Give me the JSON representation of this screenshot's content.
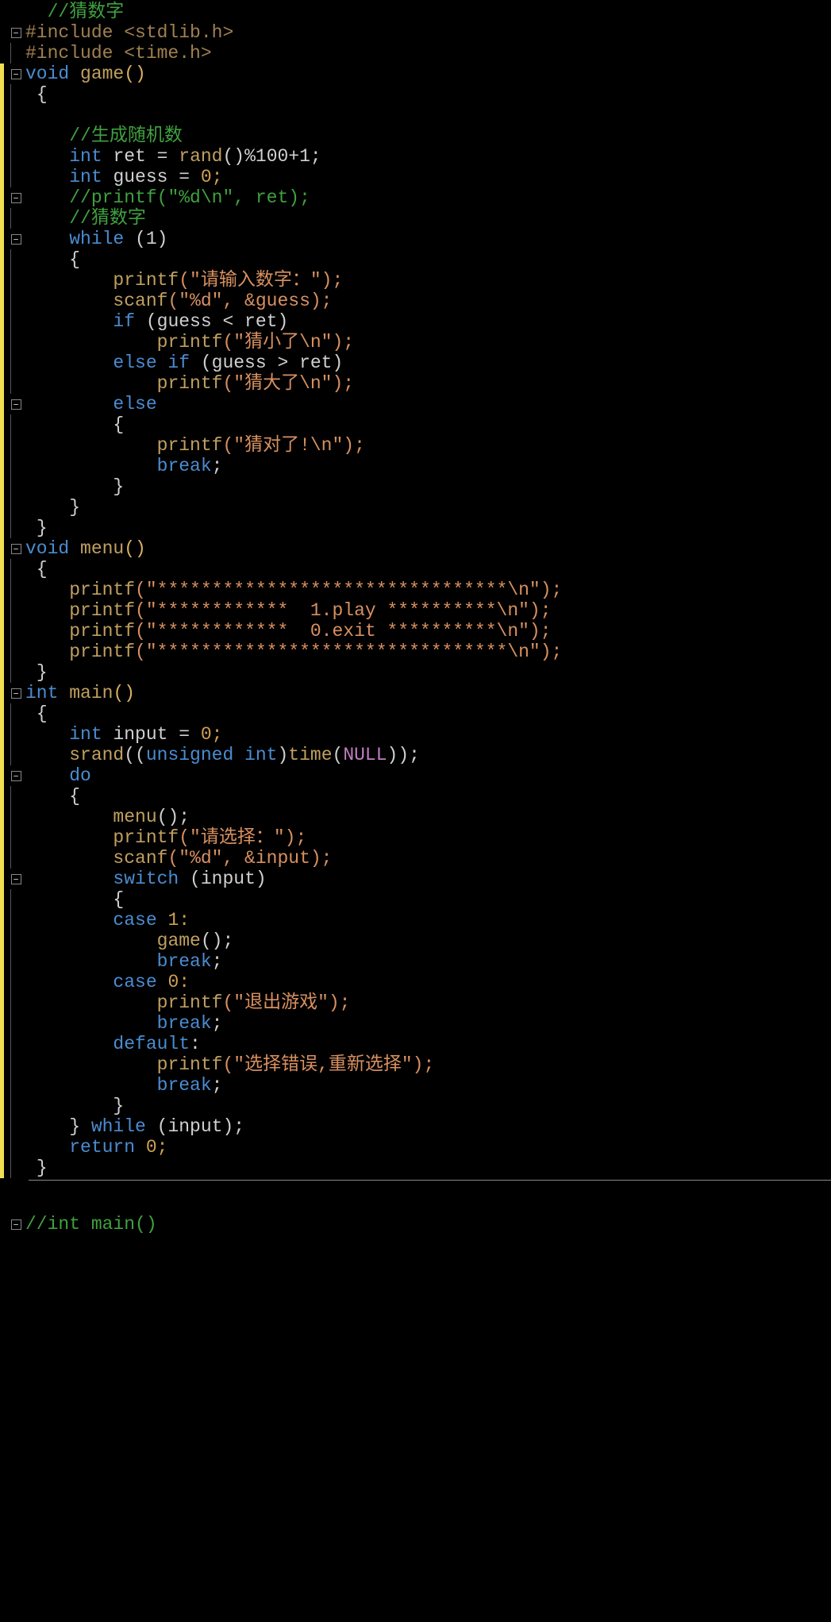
{
  "code": {
    "l1_comment": "//猜数字",
    "l2_include": "#include",
    "l2_file": " <stdlib.h>",
    "l3_include": "#include",
    "l3_file": " <time.h>",
    "l4_void": "void",
    "l4_func": " game",
    "l4_paren": "()",
    "l5_brace": "{",
    "l6_blank": "",
    "l7_comment": "//生成随机数",
    "l8_int": "int",
    "l8_var": " ret ",
    "l8_eq": "= ",
    "l8_rand": "rand",
    "l8_rest": "()%100+1;",
    "l9_int": "int",
    "l9_var": " guess ",
    "l9_eq": "= ",
    "l9_val": "0;",
    "l10_comment": "//printf(\"%d\\n\", ret);",
    "l11_comment": "//猜数字",
    "l12_while": "while",
    "l12_cond": " (1)",
    "l13_brace": "{",
    "l14_printf": "printf",
    "l14_args": "(\"请输入数字：\");",
    "l15_scanf": "scanf",
    "l15_args": "(\"%d\", &guess);",
    "l16_if": "if",
    "l16_cond": " (guess < ret)",
    "l17_printf": "printf",
    "l17_args": "(\"猜小了\\n\");",
    "l18_else": "else if",
    "l18_cond": " (guess > ret)",
    "l19_printf": "printf",
    "l19_args": "(\"猜大了\\n\");",
    "l20_else": "else",
    "l21_brace": "{",
    "l22_printf": "printf",
    "l22_args": "(\"猜对了!\\n\");",
    "l23_break": "break",
    "l23_sc": ";",
    "l24_brace": "}",
    "l25_brace": "}",
    "l26_brace": "}",
    "l27_void": "void",
    "l27_func": " menu",
    "l27_paren": "()",
    "l28_brace": "{",
    "l29_printf": "printf",
    "l29_args": "(\"********************************\\n\");",
    "l30_printf": "printf",
    "l30_args": "(\"************  1.play **********\\n\");",
    "l31_printf": "printf",
    "l31_args": "(\"************  0.exit **********\\n\");",
    "l32_printf": "printf",
    "l32_args": "(\"********************************\\n\");",
    "l33_brace": "}",
    "l34_int": "int",
    "l34_func": " main",
    "l34_paren": "()",
    "l35_brace": "{",
    "l36_int": "int",
    "l36_var": " input ",
    "l36_eq": "= ",
    "l36_val": "0;",
    "l37_srand": "srand",
    "l37_p1": "((",
    "l37_unsigned": "unsigned int",
    "l37_p2": ")",
    "l37_time": "time",
    "l37_p3": "(",
    "l37_null": "NULL",
    "l37_p4": "));",
    "l38_do": "do",
    "l39_brace": "{",
    "l40_menu": "menu",
    "l40_call": "();",
    "l41_printf": "printf",
    "l41_args": "(\"请选择：\");",
    "l42_scanf": "scanf",
    "l42_args": "(\"%d\", &input);",
    "l43_switch": "switch",
    "l43_cond": " (input)",
    "l44_brace": "{",
    "l45_case": "case",
    "l45_val": " 1:",
    "l46_game": "game",
    "l46_call": "();",
    "l47_break": "break",
    "l47_sc": ";",
    "l48_case": "case",
    "l48_val": " 0:",
    "l49_printf": "printf",
    "l49_args": "(\"退出游戏\");",
    "l50_break": "break",
    "l50_sc": ";",
    "l51_default": "default",
    "l51_sc": ":",
    "l52_printf": "printf",
    "l52_args": "(\"选择错误,重新选择\");",
    "l53_break": "break",
    "l53_sc": ";",
    "l54_brace": "}",
    "l55_brace": "} ",
    "l55_while": "while",
    "l55_cond": " (input);",
    "l56_return": "return",
    "l56_val": " 0;",
    "l57_brace": "}",
    "l60_comment": "//int main()"
  }
}
